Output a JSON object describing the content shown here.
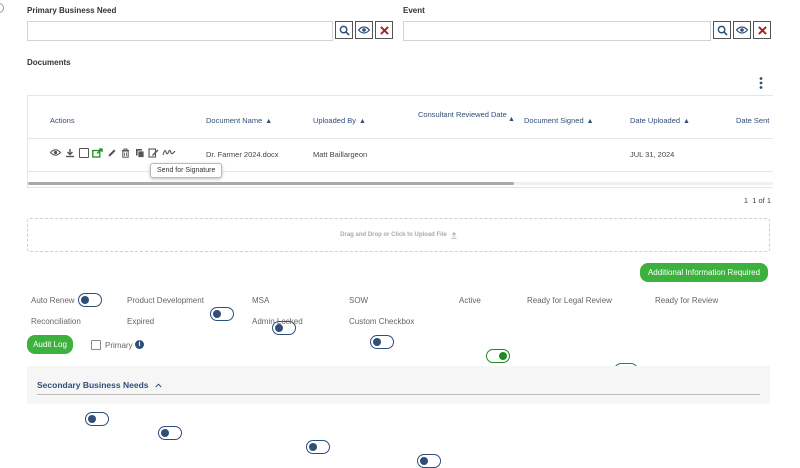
{
  "filters": {
    "primary_label": "Primary Business Need",
    "primary_value": "",
    "event_label": "Event",
    "event_value": ""
  },
  "documents": {
    "title": "Documents",
    "columns": [
      "Actions",
      "Document Name",
      "Uploaded By",
      "Consultant Reviewed Date",
      "Document Signed",
      "Date Uploaded",
      "Date Sent"
    ],
    "rows": [
      {
        "name": "Dr. Farmer 2024.docx",
        "uploaded_by": "Matt Baillargeon",
        "reviewed": "",
        "signed": "",
        "date_uploaded": "JUL 31, 2024",
        "date_sent": ""
      }
    ],
    "tooltip": "Send for Signature",
    "pagination": "1  1 of 1"
  },
  "upload": {
    "text": "Drag and Drop or Click to Upload File"
  },
  "additional_info_label": "Additional Information Required",
  "toggles": [
    {
      "label": "Auto Renew",
      "on": false
    },
    {
      "label": "Product Development",
      "on": false
    },
    {
      "label": "MSA",
      "on": false
    },
    {
      "label": "SOW",
      "on": false
    },
    {
      "label": "Active",
      "on": true
    },
    {
      "label": "Ready for Legal Review",
      "on": true
    },
    {
      "label": "Ready for Review",
      "on": true
    },
    {
      "label": "Reconciliation",
      "on": false
    },
    {
      "label": "Expired",
      "on": false
    },
    {
      "label": "Admin Locked",
      "on": false
    },
    {
      "label": "Custom Checkbox",
      "on": false
    }
  ],
  "audit_log_label": "Audit Log",
  "primary_checkbox_label": "Primary",
  "secondary": {
    "title": "Secondary Business Needs"
  },
  "colors": {
    "accent_blue": "#2f4e78",
    "green": "#3db13d",
    "toggle_on": "#1e8c1e",
    "danger": "#c0392b"
  }
}
